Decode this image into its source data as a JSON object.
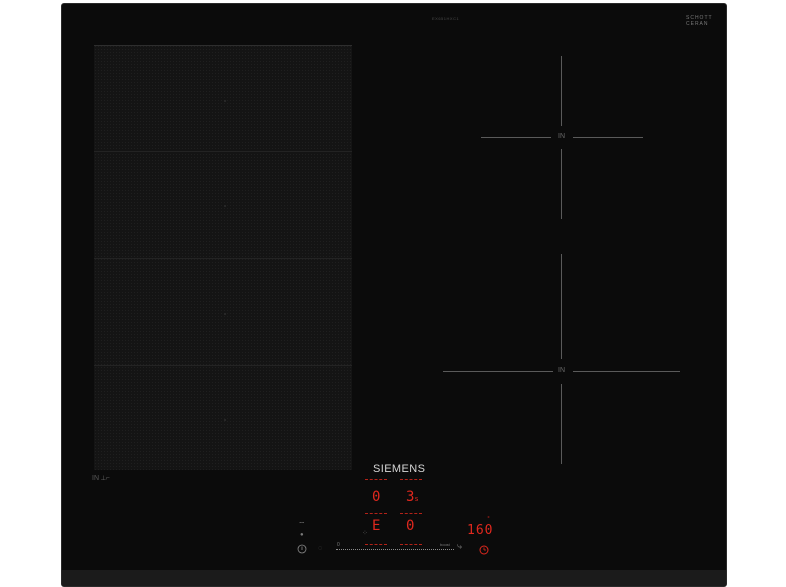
{
  "cooktop": {
    "model": "EX651HXC1",
    "schott_label": "SCHOTT\nCERAN",
    "brand": "SIEMENS",
    "flex_zone_label": "IN ⟂⌐",
    "zone_right_top_label": "IN",
    "zone_right_bottom_label": "IN"
  },
  "display": {
    "zone1_power": "0",
    "zone2_power": "3",
    "zone2_suffix": "s",
    "zone3_power": "E",
    "zone4_power": "0",
    "temperature": "160",
    "boost_label": "boost",
    "slider_min": "0"
  },
  "icons": {
    "wifi": "wifi-icon",
    "lock": "lock-icon",
    "power": "power-icon",
    "timer": "timer-icon",
    "pan": "pan-icon",
    "menu": "menu-icon"
  },
  "colors": {
    "glass": "#0b0b0b",
    "display_red": "#e0281e",
    "brand_text": "#d6d6d6"
  }
}
